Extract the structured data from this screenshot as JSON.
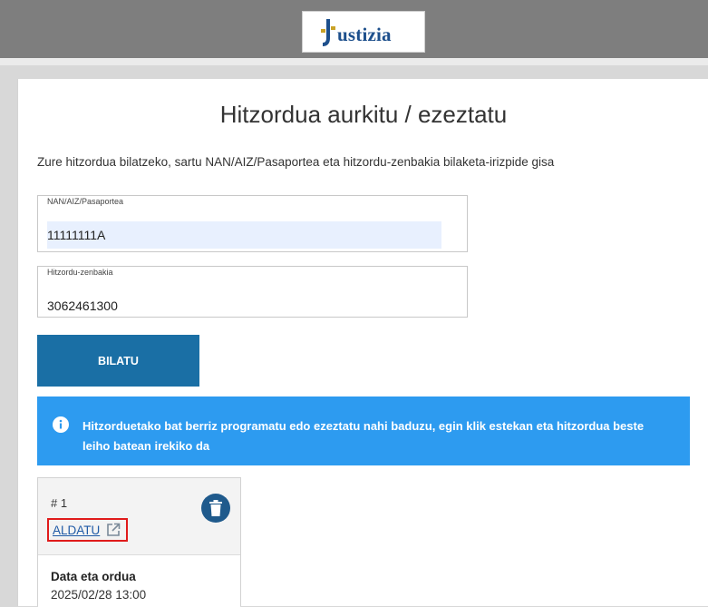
{
  "header": {
    "logo_text": "Justizia",
    "logo_visible_text": "ustizia"
  },
  "page": {
    "title": "Hitzordua aurkitu / ezeztatu",
    "instructions": "Zure hitzordua bilatzeko, sartu NAN/AIZ/Pasaportea eta hitzordu-zenbakia bilaketa-irizpide gisa"
  },
  "form": {
    "id_label": "NAN/AIZ/Pasaportea",
    "id_value": "11111111A",
    "number_label": "Hitzordu-zenbakia",
    "number_value": "3062461300",
    "search_label": "BILATU"
  },
  "info_banner": {
    "text": "Hitzorduetako bat berriz programatu edo ezeztatu nahi baduzu, egin klik estekan eta hitzordua beste leiho batean irekiko da"
  },
  "appointment": {
    "number": "# 1",
    "change_label": "ALDATU",
    "datetime_label": "Data eta ordua",
    "datetime_value": "2025/02/28 13:00"
  },
  "colors": {
    "header_bg": "#7e7e7e",
    "button_bg": "#1a6fa5",
    "info_bg": "#2d9bf0",
    "link": "#1f5aa6",
    "highlight_border": "#e01b1b",
    "trash_bg": "#1f5a8c"
  },
  "icons": {
    "logo": "justizia-logo-icon",
    "info": "info-icon",
    "delete": "trash-icon",
    "external": "external-link-icon"
  }
}
